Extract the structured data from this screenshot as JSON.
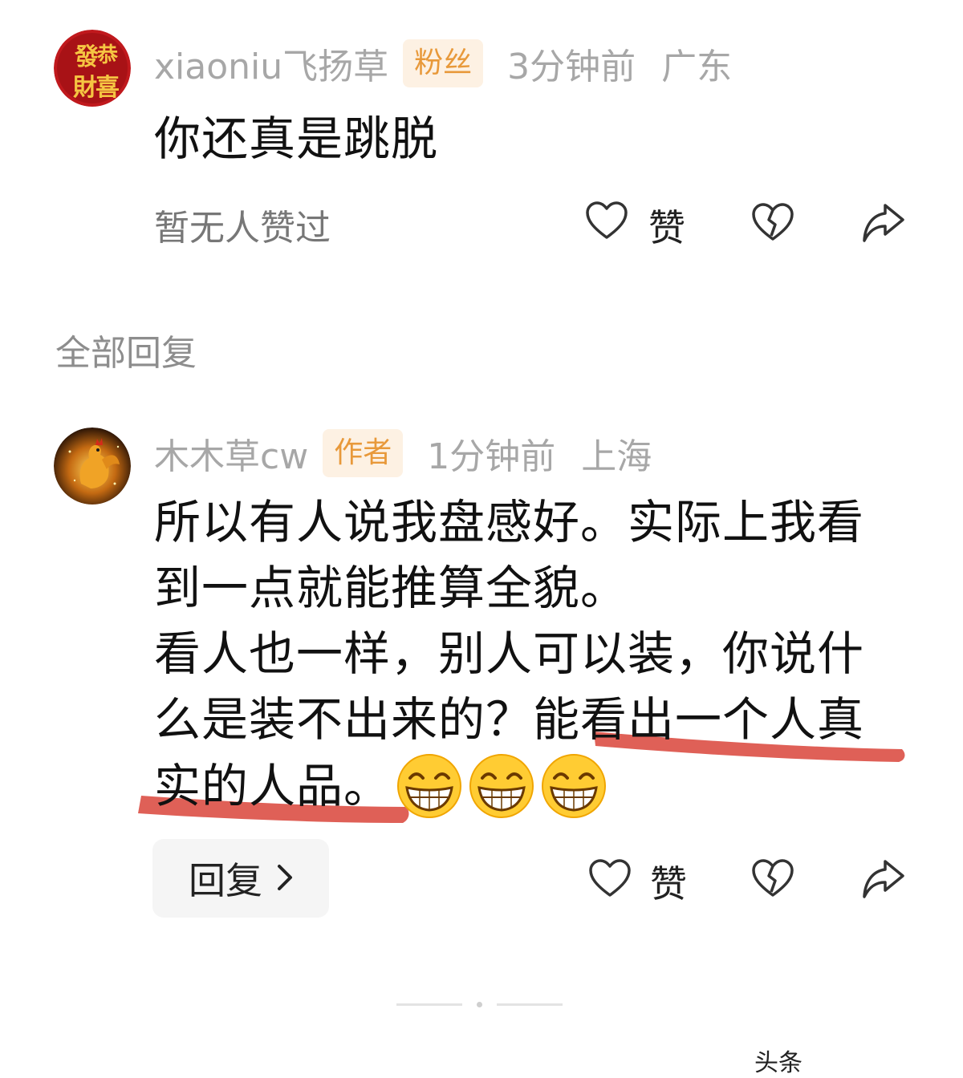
{
  "comment": {
    "username": "xiaoniu飞扬草",
    "badge": "粉丝",
    "time": "3分钟前",
    "location": "广东",
    "text": "你还真是跳脱",
    "no_likes": "暂无人赞过",
    "like_label": "赞",
    "avatar_text": "恭發財喜"
  },
  "section_title": "全部回复",
  "reply": {
    "username": "木木草cw",
    "badge": "作者",
    "time": "1分钟前",
    "location": "上海",
    "lines": [
      "所以有人说我盘感好。实际上我看",
      "到一点就能推算全貌。",
      "看人也一样，别人可以装，你说什",
      "么是装不出来的？能看出一个人真",
      "实的人品。"
    ],
    "emoji_icons": [
      "grinning-face-icon",
      "grinning-face-icon",
      "grinning-face-icon"
    ],
    "reply_button_label": "回复",
    "like_label": "赞"
  },
  "watermark": "头条",
  "colors": {
    "badge_text": "#e8993a",
    "badge_bg": "#fdf1e3",
    "underline": "#d9443a",
    "meta_gray": "#a7a7a7"
  }
}
